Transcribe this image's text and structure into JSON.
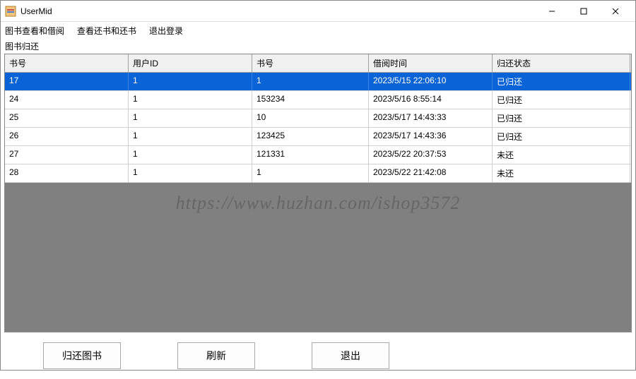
{
  "window": {
    "title": "UserMid"
  },
  "menu": {
    "item1": "图书查看和借阅",
    "item2": "查看还书和还书",
    "item3": "退出登录"
  },
  "section": {
    "label": "图书归还"
  },
  "grid": {
    "headers": {
      "c0": "书号",
      "c1": "用户ID",
      "c2": "书号",
      "c3": "借阅时间",
      "c4": "归还状态"
    },
    "rows": [
      {
        "c0": "17",
        "c1": "1",
        "c2": "1",
        "c3": "2023/5/15 22:06:10",
        "c4": "已归还",
        "selected": true
      },
      {
        "c0": "24",
        "c1": "1",
        "c2": "153234",
        "c3": "2023/5/16 8:55:14",
        "c4": "已归还",
        "selected": false
      },
      {
        "c0": "25",
        "c1": "1",
        "c2": "10",
        "c3": "2023/5/17 14:43:33",
        "c4": "已归还",
        "selected": false
      },
      {
        "c0": "26",
        "c1": "1",
        "c2": "123425",
        "c3": "2023/5/17 14:43:36",
        "c4": "已归还",
        "selected": false
      },
      {
        "c0": "27",
        "c1": "1",
        "c2": "121331",
        "c3": "2023/5/22 20:37:53",
        "c4": "未还",
        "selected": false
      },
      {
        "c0": "28",
        "c1": "1",
        "c2": "1",
        "c3": "2023/5/22 21:42:08",
        "c4": "未还",
        "selected": false
      }
    ]
  },
  "buttons": {
    "return_book": "归还图书",
    "refresh": "刷新",
    "exit": "退出"
  },
  "watermark": "https://www.huzhan.com/ishop3572"
}
